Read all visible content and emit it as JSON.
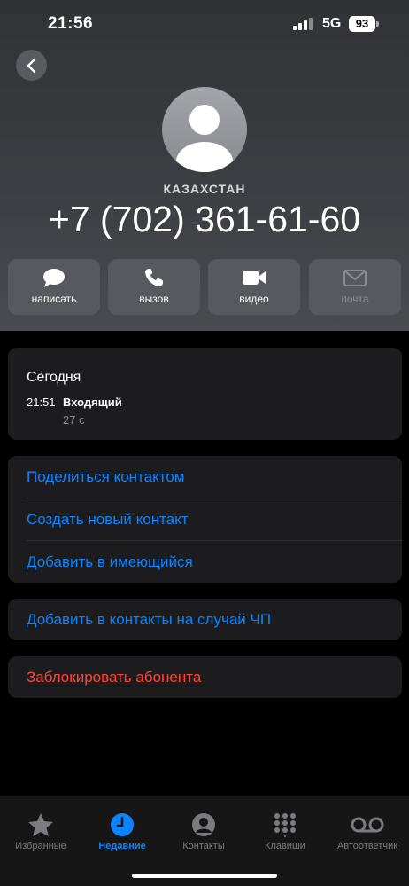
{
  "status_bar": {
    "time": "21:56",
    "network": "5G",
    "battery": "93"
  },
  "contact": {
    "country": "КАЗАХСТАН",
    "phone": "+7 (702) 361-61-60"
  },
  "actions": [
    {
      "label": "написать",
      "icon": "message-icon",
      "enabled": true
    },
    {
      "label": "вызов",
      "icon": "phone-icon",
      "enabled": true
    },
    {
      "label": "видео",
      "icon": "video-icon",
      "enabled": true
    },
    {
      "label": "почта",
      "icon": "mail-icon",
      "enabled": false
    }
  ],
  "recent_calls": {
    "title": "Сегодня",
    "entries": [
      {
        "time": "21:51",
        "type": "Входящий",
        "duration": "27 с"
      }
    ]
  },
  "contact_options": [
    "Поделиться контактом",
    "Создать новый контакт",
    "Добавить в имеющийся"
  ],
  "emergency_option": "Добавить в контакты на случай ЧП",
  "block_option": "Заблокировать абонента",
  "colors": {
    "accent": "#0a84ff",
    "danger": "#ff453a",
    "card": "#1c1c1e"
  },
  "tab_bar": {
    "active_index": 1,
    "tabs": [
      {
        "label": "Избранные",
        "icon": "star-icon"
      },
      {
        "label": "Недавние",
        "icon": "clock-icon"
      },
      {
        "label": "Контакты",
        "icon": "person-circle-icon"
      },
      {
        "label": "Клавиши",
        "icon": "keypad-icon"
      },
      {
        "label": "Автоответчик",
        "icon": "voicemail-icon"
      }
    ]
  }
}
